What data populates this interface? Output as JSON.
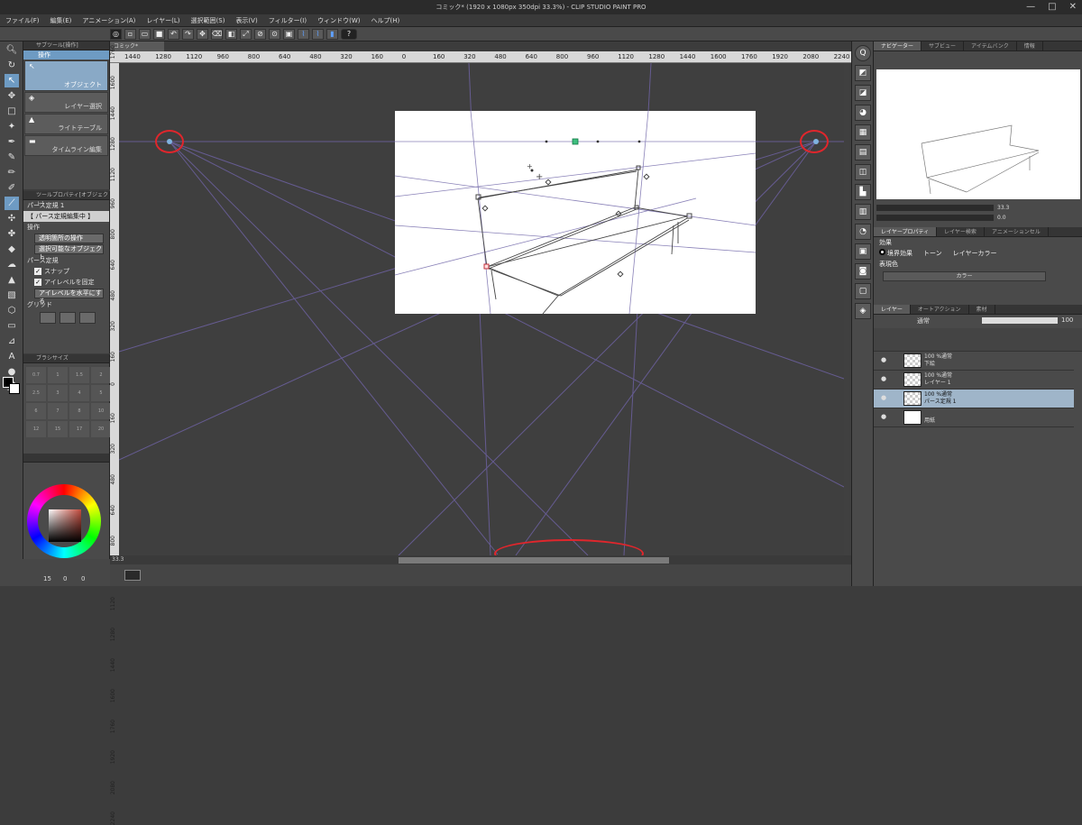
{
  "window": {
    "title": "コミック* (1920 x 1080px 350dpi 33.3%) - CLIP STUDIO PAINT PRO",
    "controls": [
      "—",
      "□",
      "✕"
    ]
  },
  "menu": [
    "ファイル(F)",
    "編集(E)",
    "アニメーション(A)",
    "レイヤー(L)",
    "選択範囲(S)",
    "表示(V)",
    "フィルター(I)",
    "ウィンドウ(W)",
    "ヘルプ(H)"
  ],
  "command_bar": {
    "help": "?"
  },
  "subtool": {
    "header": "サブツール[操作]",
    "tab": "操作",
    "items": [
      "オブジェクト",
      "レイヤー選択",
      "ライトテーブル",
      "タイムライン編集"
    ]
  },
  "tool_property": {
    "header": "ツールプロパティ[オブジェクト]",
    "name": "パース定規 1",
    "mode": "【 パース定規編集中 】",
    "operation_label": "操作",
    "operation_value": "透明箇所の操作",
    "selectable_value": "選択可能なオブジェクト",
    "perspective_label": "パース定規",
    "snap_label": "スナップ",
    "fix_eyelevel_label": "アイレベルを固定",
    "level_eyelevel_button": "アイレベルを水平にする",
    "grid_label": "グリッド"
  },
  "brush_size": {
    "header": "ブラシサイズ",
    "sizes": [
      "0.7",
      "1",
      "1.5",
      "2",
      "2.5",
      "3",
      "4",
      "5",
      "6",
      "7",
      "8",
      "10",
      "12",
      "15",
      "17",
      "20"
    ]
  },
  "color": {
    "header": "",
    "accent": "#c24b3d"
  },
  "left_bottom": {
    "values": [
      "15",
      "0",
      "0"
    ]
  },
  "document": {
    "tab": "コミック*",
    "ruler_h": [
      "1440",
      "1280",
      "1120",
      "960",
      "800",
      "640",
      "480",
      "320",
      "160",
      "0",
      "160",
      "320",
      "480",
      "640",
      "800",
      "960",
      "1120",
      "1280",
      "1440",
      "1600",
      "1760",
      "1920",
      "2080",
      "2240"
    ],
    "ruler_v": [
      "1760",
      "1600",
      "1440",
      "1280",
      "1120",
      "960",
      "800",
      "640",
      "480",
      "320",
      "160",
      "0",
      "160",
      "320",
      "480",
      "640",
      "800",
      "960",
      "1120",
      "1280",
      "1440",
      "1600",
      "1760",
      "1920",
      "2080",
      "2240"
    ],
    "zoom": "33.3"
  },
  "navigator": {
    "tabs": [
      "ナビゲーター",
      "サブビュー",
      "アイテムバンク",
      "情報"
    ],
    "zoom_value": "33.3",
    "angle_value": "0.0"
  },
  "layer_property": {
    "tabs": [
      "レイヤープロパティ",
      "レイヤー検索",
      "アニメーションセル"
    ],
    "effect_label": "効果",
    "effects": [
      "境界効果",
      "トーン",
      "レイヤーカラー"
    ],
    "expression_label": "表現色",
    "expression_value": "カラー"
  },
  "layers": {
    "tabs": [
      "レイヤー",
      "オートアクション",
      "素材"
    ],
    "blend_mode": "通常",
    "opacity": "100",
    "items": [
      {
        "line1": "100 %通常",
        "line2": "下絵",
        "selected": false
      },
      {
        "line1": "100 %通常",
        "line2": "レイヤー 1",
        "selected": false
      },
      {
        "line1": "100 %通常",
        "line2": "パース定規 1",
        "selected": true
      },
      {
        "line1": "",
        "line2": "用紙",
        "selected": false
      }
    ]
  }
}
